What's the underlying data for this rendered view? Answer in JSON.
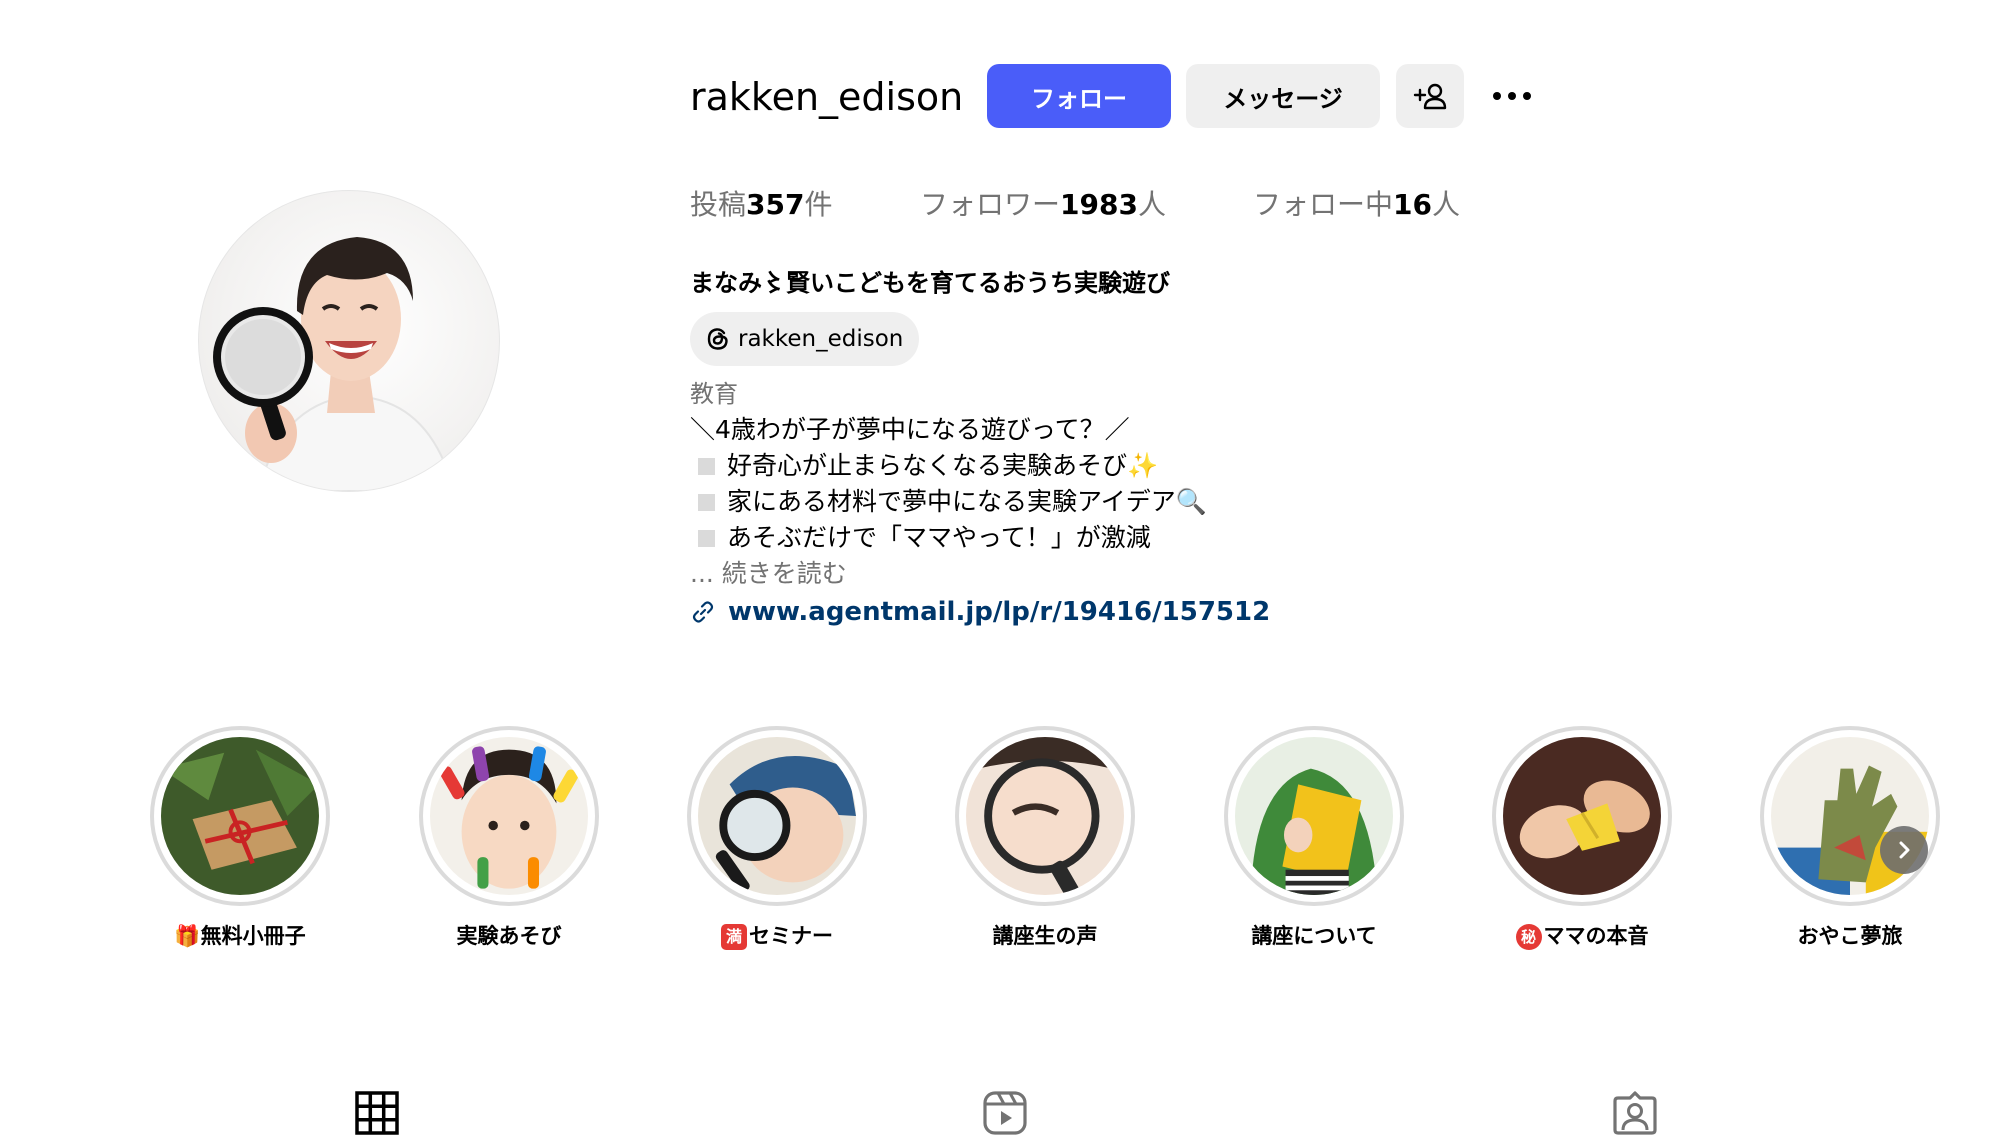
{
  "profile": {
    "username": "rakken_edison",
    "follow_label": "フォロー",
    "message_label": "メッセージ",
    "suggest_icon": "add-person-icon",
    "more_icon": "more-options-icon"
  },
  "stats": {
    "posts_prefix": "投稿",
    "posts_count": "357",
    "posts_suffix": "件",
    "followers_prefix": "フォロワー",
    "followers_count": "1983",
    "followers_suffix": "人",
    "following_prefix": "フォロー中",
    "following_count": "16",
    "following_suffix": "人"
  },
  "bio": {
    "display_name": "まなみ〻賢いこどもを育てるおうち実験遊び",
    "threads_handle": "rakken_edison",
    "category": "教育",
    "line1": "＼4歳わが子が夢中になる遊びって？／",
    "line2": "好奇心が止まらなくなる実験あそび✨",
    "line3": "家にある材料で夢中になる実験アイデア🔍",
    "line4": "あそぶだけで「ママやって！」が激減",
    "read_more": "... 続きを読む",
    "link": "www.agentmail.jp/lp/r/19416/157512"
  },
  "highlights": [
    {
      "emoji": "🎁",
      "label": "無料小冊子"
    },
    {
      "emoji": "",
      "label": "実験あそび"
    },
    {
      "emoji": "満",
      "label": "セミナー"
    },
    {
      "emoji": "",
      "label": "講座生の声"
    },
    {
      "emoji": "",
      "label": "講座について"
    },
    {
      "emoji": "秘",
      "label": "ママの本音"
    },
    {
      "emoji": "",
      "label": "おやこ夢旅"
    }
  ],
  "tabs": [
    {
      "icon": "grid-icon"
    },
    {
      "icon": "reels-icon"
    },
    {
      "icon": "tagged-icon"
    }
  ],
  "colors": {
    "primary_button": "#4a5df9",
    "secondary_button": "#efefef",
    "link": "#00376b",
    "muted_text": "#737373",
    "highlight_ring": "#dbdbdb"
  }
}
